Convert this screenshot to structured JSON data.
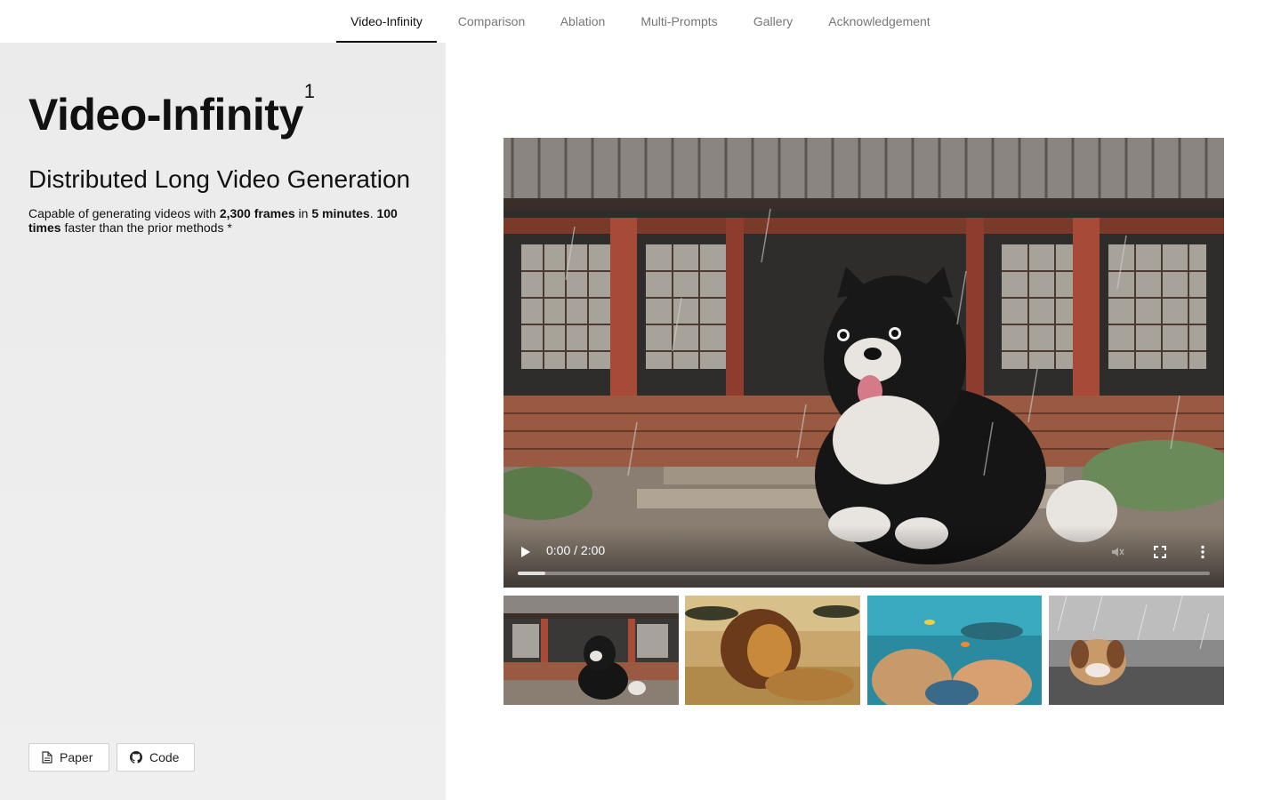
{
  "nav": {
    "tabs": [
      {
        "label": "Video-Infinity",
        "active": true
      },
      {
        "label": "Comparison",
        "active": false
      },
      {
        "label": "Ablation",
        "active": false
      },
      {
        "label": "Multi-Prompts",
        "active": false
      },
      {
        "label": "Gallery",
        "active": false
      },
      {
        "label": "Acknowledgement",
        "active": false
      }
    ]
  },
  "hero": {
    "title": "Video-Infinity",
    "title_superscript": "1",
    "subtitle": "Distributed Long Video Generation",
    "desc": {
      "p1": "Capable of generating videos with ",
      "b1": "2,300 frames",
      "p2": " in ",
      "b2": "5 minutes",
      "p3": ". ",
      "b3": "100 times",
      "p4": " faster than the prior methods *"
    }
  },
  "links": {
    "paper_label": "Paper",
    "paper_icon": "document-icon",
    "code_label": "Code",
    "code_icon": "github-icon"
  },
  "player": {
    "time_display": "0:00 / 2:00",
    "progress_fraction": 0.04,
    "play_icon": "play-icon",
    "volume_icon": "volume-muted-icon",
    "fullscreen_icon": "fullscreen-icon",
    "menu_icon": "more-vert-icon"
  },
  "thumbnails": [
    "dog-temple-thumb",
    "lion-thumb",
    "coral-reef-thumb",
    "puppy-rain-thumb"
  ],
  "colors": {
    "sidebar_bg": "#ebebeb",
    "active_tab": "#111111",
    "inactive_tab": "#777777"
  }
}
